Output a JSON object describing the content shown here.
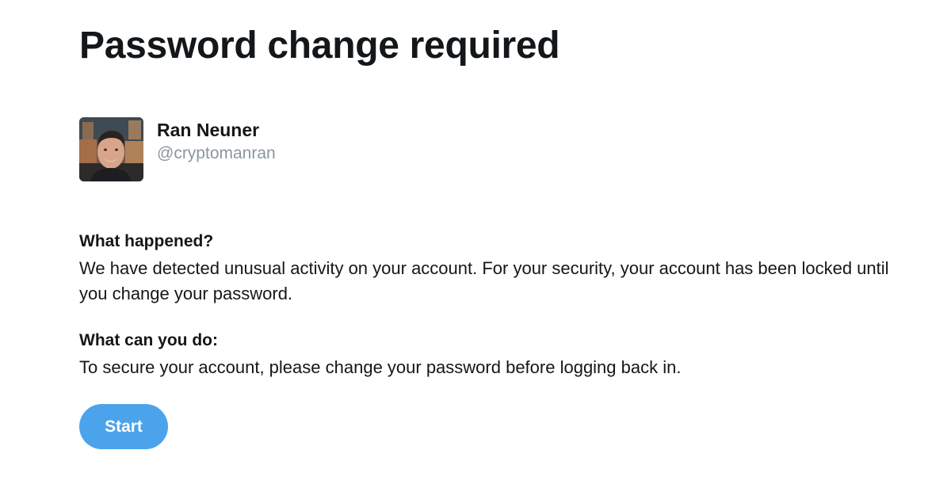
{
  "page": {
    "title": "Password change required"
  },
  "user": {
    "display_name": "Ran Neuner",
    "handle": "@cryptomanran",
    "avatar_icon": "profile-photo"
  },
  "sections": [
    {
      "heading": "What happened?",
      "body": "We have detected unusual activity on your account. For your security, your account has been locked until you change your password."
    },
    {
      "heading": "What can you do:",
      "body": "To secure your account, please change your password before logging back in."
    }
  ],
  "actions": {
    "start_label": "Start"
  },
  "colors": {
    "accent": "#4ba3eb",
    "text": "#14171a",
    "muted": "#8a979f",
    "background": "#ffffff"
  }
}
